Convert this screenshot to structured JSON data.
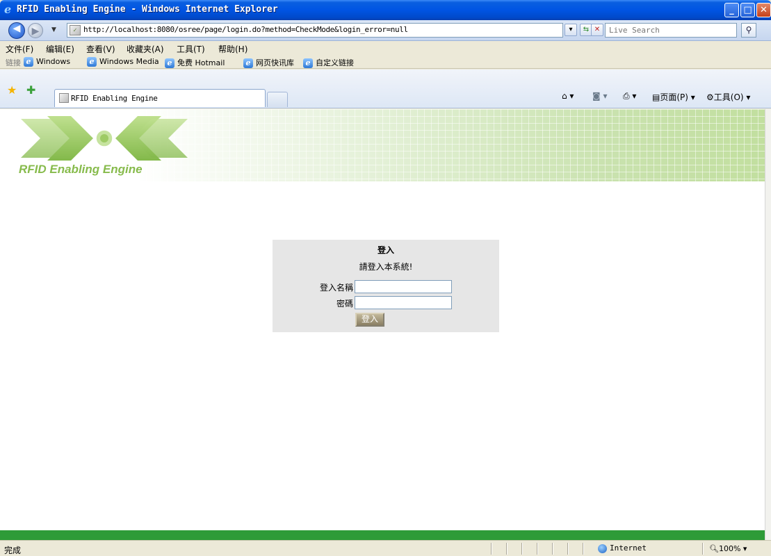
{
  "window": {
    "title": "RFID Enabling Engine - Windows Internet Explorer"
  },
  "address": {
    "url": "http://localhost:8080/osree/page/login.do?method=CheckMode&login_error=null",
    "search_placeholder": "Live Search"
  },
  "menu": [
    "文件(F)",
    "编辑(E)",
    "查看(V)",
    "收藏夹(A)",
    "工具(T)",
    "帮助(H)"
  ],
  "links": {
    "label": "链接",
    "items": [
      "Windows",
      "Windows Media",
      "免费 Hotmail",
      "网页快讯库",
      "自定义链接"
    ]
  },
  "tabs": {
    "active_label": "RFID Enabling Engine"
  },
  "commandbar": {
    "page": "页面(P)",
    "tools": "工具(O)"
  },
  "banner": {
    "brand": "RFID Enabling Engine"
  },
  "login": {
    "title": "登入",
    "subtitle": "請登入本系統!",
    "username_label": "登入名稱",
    "password_label": "密碼",
    "username_value": "",
    "password_value": "",
    "submit_label": "登入"
  },
  "status": {
    "text": "完成",
    "zone": "Internet",
    "zoom": "100%"
  },
  "colors": {
    "accent_green": "#2e9b38",
    "brand_green": "#87bb4c",
    "title_blue": "#0054e3"
  }
}
